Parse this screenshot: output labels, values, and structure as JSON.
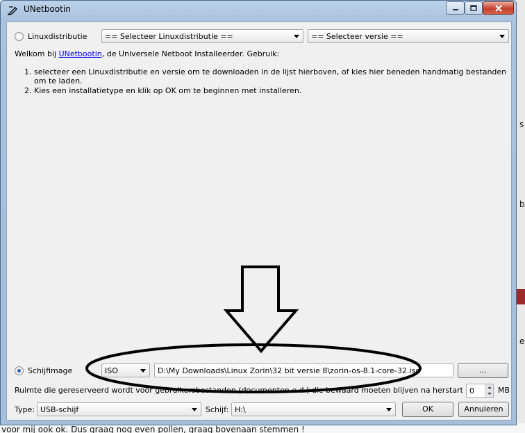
{
  "background": {
    "right_letters": [
      "s",
      "b",
      "e"
    ],
    "bottom_text": "voor mij ook ok. Dus graag nog even pollen, graag bovenaan stemmen !"
  },
  "window": {
    "title": "UNetbootin",
    "controls": {
      "minimize": "minimize",
      "maximize": "maximize",
      "close": "close"
    }
  },
  "distribution": {
    "radio_label": "Linuxdistributie",
    "selected": false,
    "distro_select": "== Selecteer Linuxdistributie ==",
    "version_select": "== Selecteer versie =="
  },
  "intro": {
    "prefix": "Welkom bij ",
    "link_text": "UNetbootin",
    "suffix": ", de Universele Netboot Installeerder. Gebruik:",
    "steps": [
      "selecteer een Linuxdistributie en versie om te downloaden in de lijst hierboven, of kies hier beneden handmatig bestanden om te laden.",
      "Kies een installatietype en klik op OK om te beginnen met installeren."
    ]
  },
  "diskimage": {
    "radio_label": "Schijfimage",
    "selected": true,
    "format": "ISO",
    "path": "D:\\My Downloads\\Linux Zorin\\32 bit versie 8\\zorin-os-8.1-core-32.iso",
    "browse_label": "..."
  },
  "reserve": {
    "text": "Ruimte die gereserveerd wordt voor gebruikersbestanden (documenten e.d.) die bewaard moeten blijven na herstart (alleen voor Ubuntu)",
    "value": "0",
    "unit": "MB"
  },
  "target": {
    "type_label": "Type:",
    "type_value": "USB-schijf",
    "drive_label": "Schijf:",
    "drive_value": "H:\\",
    "ok_label": "OK",
    "cancel_label": "Annuleren"
  },
  "annotation": {
    "arrow": "down-arrow",
    "shape": "ellipse",
    "color": "#000000"
  },
  "colors": {
    "link": "#0000ee",
    "radio_dot": "#2864b8",
    "title_bar": "#a9c2de",
    "close_button": "#c7402c"
  }
}
